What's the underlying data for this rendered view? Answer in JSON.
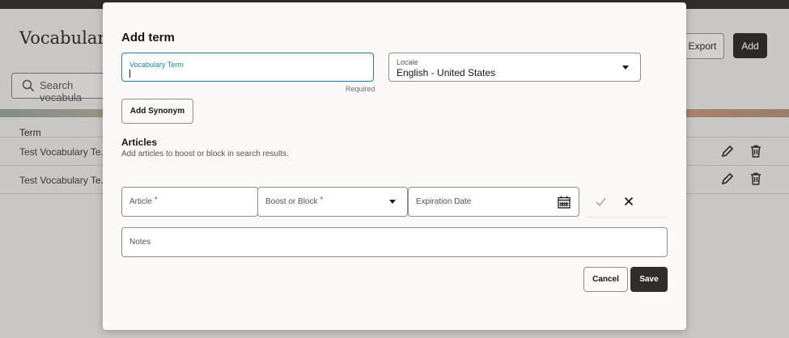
{
  "background": {
    "page_title": "Vocabulary",
    "search_placeholder": "Search vocabula",
    "export_label": "Export",
    "add_label": "Add",
    "table_header": "Term",
    "rows": [
      {
        "term": "Test Vocabulary Te..."
      },
      {
        "term": "Test Vocabulary Te..."
      }
    ]
  },
  "modal": {
    "title": "Add term",
    "vocabulary_term": {
      "label": "Vocabulary Term",
      "value": "",
      "hint": "Required"
    },
    "locale": {
      "label": "Locale",
      "value": "English - United States"
    },
    "add_synonym_label": "Add Synonym",
    "articles": {
      "title": "Articles",
      "description": "Add articles to boost or block in search results.",
      "article_placeholder": "Article",
      "boost_placeholder": "Boost or Block",
      "required_mark": "*",
      "expiration_placeholder": "Expiration Date"
    },
    "notes_placeholder": "Notes",
    "cancel_label": "Cancel",
    "save_label": "Save"
  },
  "colors": {
    "accent": "#227e9e",
    "primary_button": "#312d2a",
    "modal_bg": "#fbf9f8",
    "overlay_bg": "#c9c7c5"
  },
  "icons": [
    "search-icon",
    "edit-icon",
    "delete-icon",
    "chevron-down-icon",
    "calendar-icon",
    "check-icon",
    "close-icon"
  ]
}
